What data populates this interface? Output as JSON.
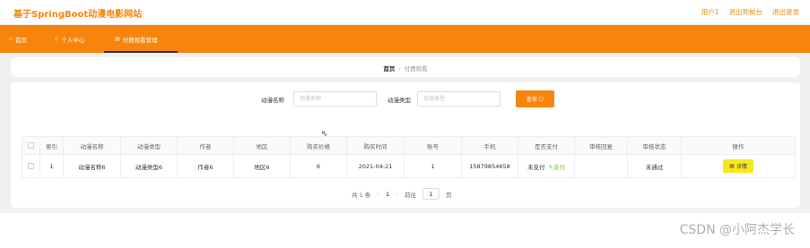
{
  "header": {
    "brand": "基于SpringBoot动漫电影网站",
    "links": [
      "用户1",
      "退出到前台",
      "退出登录"
    ]
  },
  "nav": {
    "items": [
      {
        "icon": "home-icon",
        "label": "首页"
      },
      {
        "icon": "user-icon",
        "label": "个人中心"
      },
      {
        "icon": "grid-icon",
        "label": "付费观看管理"
      }
    ]
  },
  "breadcrumb": {
    "home": "首页",
    "separator": "/",
    "current": "付费观看"
  },
  "search": {
    "name_label": "动漫名称",
    "name_placeholder": "动漫名称",
    "type_label": "动漫类型",
    "type_placeholder": "动漫类型",
    "button_label": "查询"
  },
  "table": {
    "columns": [
      "索引",
      "动漫名称",
      "动漫类型",
      "作者",
      "地区",
      "购买价格",
      "购买时间",
      "账号",
      "手机",
      "是否支付",
      "审核回复",
      "审核状态",
      "操作"
    ],
    "rows": [
      {
        "index": "1",
        "name": "动漫名称6",
        "type": "动漫类型6",
        "author": "作者6",
        "region": "地区6",
        "price": "6",
        "time": "2021-04-21",
        "account": "1",
        "phone": "15879854658",
        "paid": "未支付",
        "pay_action": "支付",
        "reply": "",
        "status": "未通过",
        "detail_label": "详情"
      }
    ]
  },
  "pagination": {
    "total": "共 1 条",
    "current_page": "1",
    "goto_label": "前往",
    "goto_value": "1",
    "page_unit": "页"
  },
  "watermark": "CSDN @小阿杰学长",
  "colors": {
    "accent": "#f7850d",
    "detail_button": "#f8e71c",
    "pay_link": "#67c23a"
  }
}
